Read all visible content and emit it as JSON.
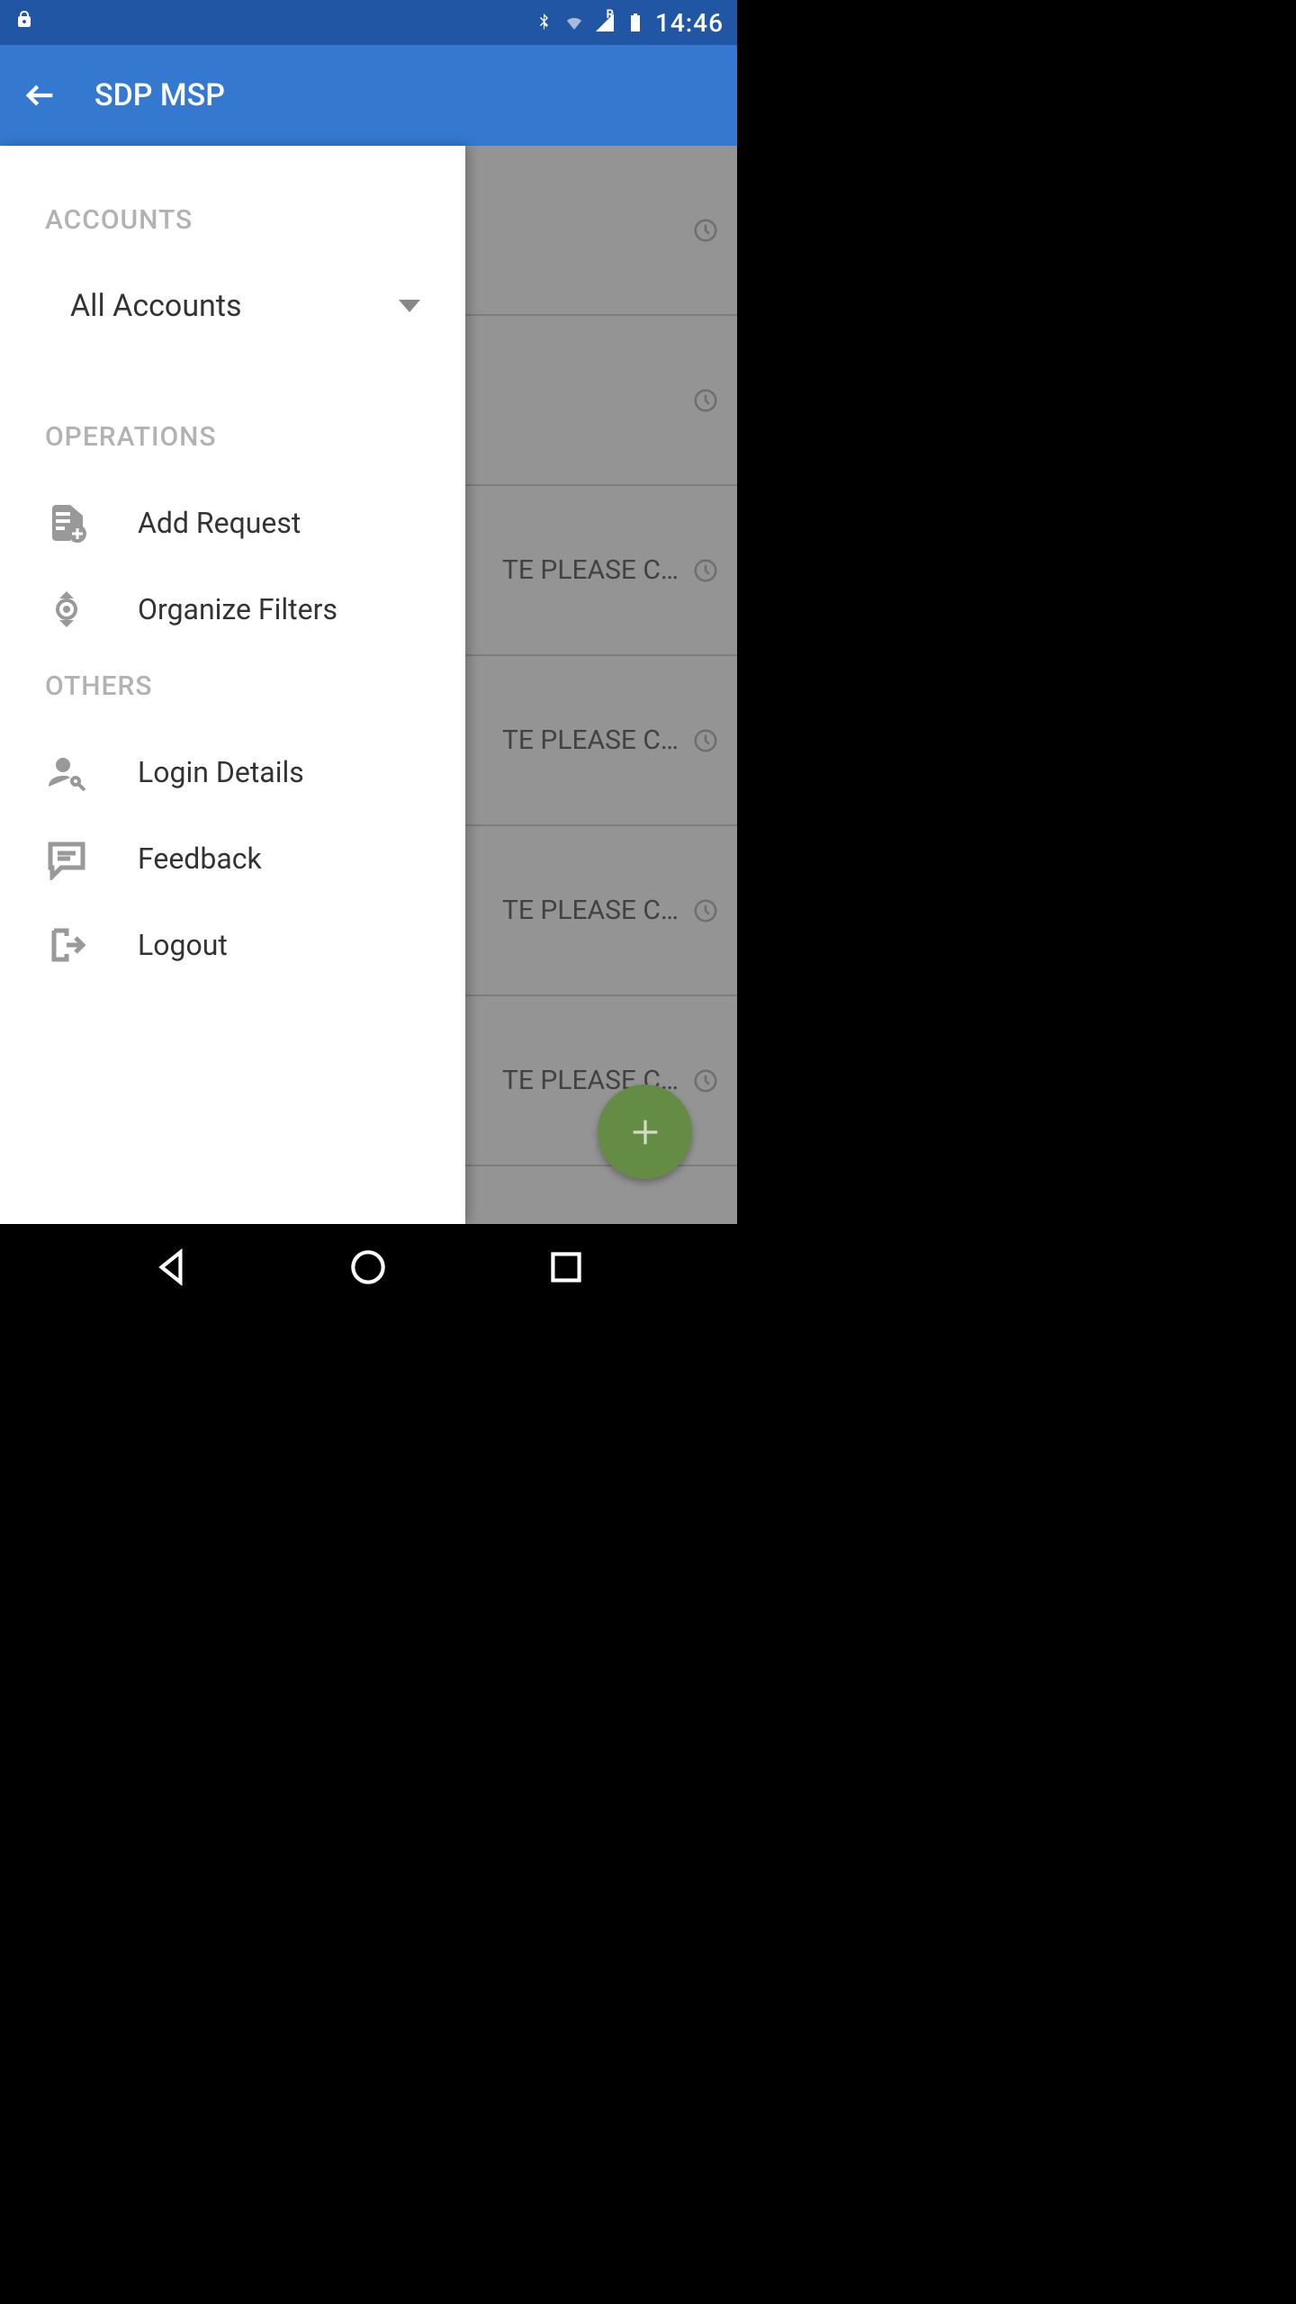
{
  "status_bar": {
    "time": "14:46",
    "network_indicator": "R"
  },
  "header": {
    "title": "SDP MSP"
  },
  "drawer": {
    "accounts_header": "ACCOUNTS",
    "account_selected": "All Accounts",
    "operations_header": "OPERATIONS",
    "operations": [
      {
        "label": "Add Request",
        "icon": "add-request"
      },
      {
        "label": "Organize Filters",
        "icon": "organize-filters"
      }
    ],
    "others_header": "OTHERS",
    "others": [
      {
        "label": "Login Details",
        "icon": "login-details"
      },
      {
        "label": "Feedback",
        "icon": "feedback"
      },
      {
        "label": "Logout",
        "icon": "logout"
      }
    ]
  },
  "bg_list": {
    "item_text": "TE PLEASE C…"
  },
  "colors": {
    "status_bar": "#2156a5",
    "app_bar": "#3479cf",
    "fab": "#658c45"
  }
}
